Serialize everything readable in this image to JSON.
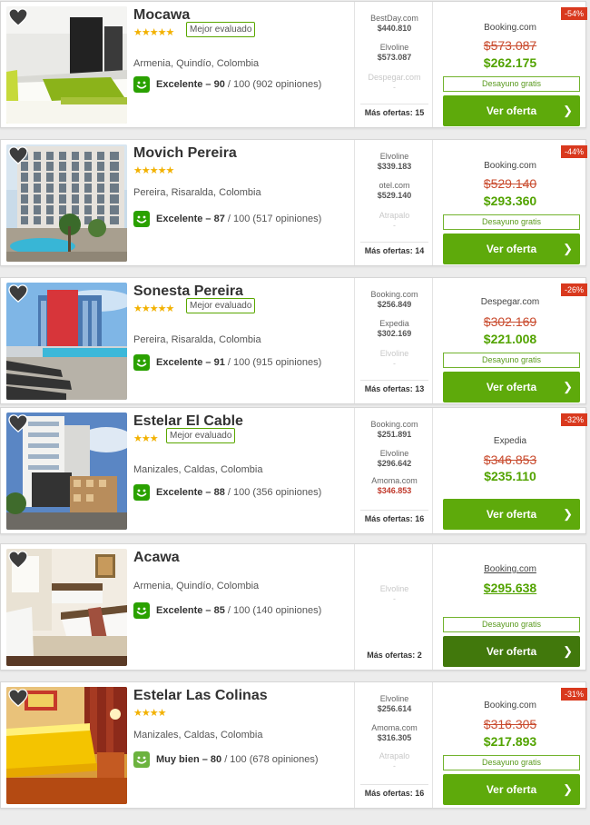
{
  "hotels": [
    {
      "name": "Mocawa",
      "stars": "★★★★★",
      "badge": "Mejor evaluado",
      "location": "Armenia, Quindío, Colombia",
      "rating_label": "Excelente – 90",
      "rating_suffix": " / 100 (902 opiniones)",
      "other_offers": [
        {
          "source": "BestDay.com",
          "price": "$440.810"
        },
        {
          "source": "Elvoline",
          "price": "$573.087"
        },
        {
          "source": "Despegar.com",
          "price": "-"
        }
      ],
      "more_offers": "Más ofertas: 15",
      "discount": "-54%",
      "provider": "Booking.com",
      "old_price": "$573.087",
      "new_price": "$262.175",
      "breakfast": "Desayuno gratis",
      "cta": "Ver oferta"
    },
    {
      "name": "Movich Pereira",
      "stars": "★★★★★",
      "badge": "",
      "location": "Pereira, Risaralda, Colombia",
      "rating_label": "Excelente – 87",
      "rating_suffix": " / 100 (517 opiniones)",
      "other_offers": [
        {
          "source": "Elvoline",
          "price": "$339.183"
        },
        {
          "source": "otel.com",
          "price": "$529.140"
        },
        {
          "source": "Atrapalo",
          "price": "-"
        }
      ],
      "more_offers": "Más ofertas: 14",
      "discount": "-44%",
      "provider": "Booking.com",
      "old_price": "$529.140",
      "new_price": "$293.360",
      "breakfast": "Desayuno gratis",
      "cta": "Ver oferta"
    },
    {
      "name": "Sonesta Pereira",
      "stars": "★★★★★",
      "badge": "Mejor evaluado",
      "location": "Pereira, Risaralda, Colombia",
      "rating_label": "Excelente – 91",
      "rating_suffix": " / 100 (915 opiniones)",
      "other_offers": [
        {
          "source": "Booking.com",
          "price": "$256.849"
        },
        {
          "source": "Expedia",
          "price": "$302.169"
        },
        {
          "source": "Elvoline",
          "price": "-"
        }
      ],
      "more_offers": "Más ofertas: 13",
      "discount": "-26%",
      "provider": "Despegar.com",
      "old_price": "$302.169",
      "new_price": "$221.008",
      "breakfast": "Desayuno gratis",
      "cta": "Ver oferta"
    },
    {
      "name": "Estelar El Cable",
      "stars": "★★★",
      "badge": "Mejor evaluado",
      "location": "Manizales, Caldas, Colombia",
      "rating_label": "Excelente – 88",
      "rating_suffix": " / 100 (356 opiniones)",
      "other_offers": [
        {
          "source": "Booking.com",
          "price": "$251.891"
        },
        {
          "source": "Elvoline",
          "price": "$296.642"
        },
        {
          "source": "Amoma.com",
          "price": "$346.853"
        }
      ],
      "more_offers": "Más ofertas: 16",
      "discount": "-32%",
      "provider": "Expedia",
      "old_price": "$346.853",
      "new_price": "$235.110",
      "breakfast": "",
      "cta": "Ver oferta"
    },
    {
      "name": "Acawa",
      "stars": "",
      "badge": "",
      "location": "Armenia, Quindío, Colombia",
      "rating_label": "Excelente – 85",
      "rating_suffix": " / 100 (140 opiniones)",
      "other_offers": [
        {
          "source": "Elvoline",
          "price": "-"
        }
      ],
      "more_offers": "Más ofertas: 2",
      "discount": "",
      "provider": "Booking.com",
      "old_price": "",
      "new_price": "$295.638",
      "breakfast": "Desayuno gratis",
      "cta": "Ver oferta"
    },
    {
      "name": "Estelar Las Colinas",
      "stars": "★★★★",
      "badge": "",
      "location": "Manizales, Caldas, Colombia",
      "rating_label": "Muy bien – 80",
      "rating_suffix": " / 100 (678 opiniones)",
      "other_offers": [
        {
          "source": "Elvoline",
          "price": "$256.614"
        },
        {
          "source": "Amoma.com",
          "price": "$316.305"
        },
        {
          "source": "Atrapalo",
          "price": "-"
        }
      ],
      "more_offers": "Más ofertas: 16",
      "discount": "-31%",
      "provider": "Booking.com",
      "old_price": "$316.305",
      "new_price": "$217.893",
      "breakfast": "Desayuno gratis",
      "cta": "Ver oferta"
    }
  ],
  "colors": {
    "cta_green": "#5eaa0b",
    "cta_green_hover": "#41780c",
    "price_green": "#52a300",
    "old_price_red": "#c94b2e",
    "discount_red": "#d9391e",
    "star_gold": "#f2b100",
    "smiley_excellent": "#2aa100",
    "smiley_good": "#6cb33f"
  },
  "icons": {
    "favorite": "heart-icon",
    "rating": "smiley-icon",
    "cta": "chevron-right-icon"
  }
}
